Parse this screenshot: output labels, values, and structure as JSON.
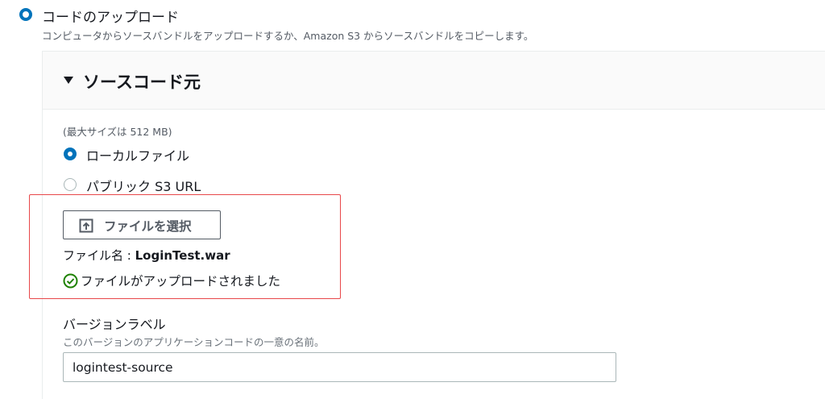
{
  "upload_option": {
    "label": "コードのアップロード",
    "description": "コンピュータからソースバンドルをアップロードするか、Amazon S3 からソースバンドルをコピーします。",
    "selected": true
  },
  "source_section": {
    "title": "ソースコード元",
    "max_size_hint": "(最大サイズは 512 MB)",
    "options": [
      {
        "label": "ローカルファイル",
        "selected": true
      },
      {
        "label": "パブリック S3 URL",
        "selected": false
      }
    ],
    "choose_file_button": "ファイルを選択",
    "file_name_label": "ファイル名 :",
    "file_name_value": "LoginTest.war",
    "upload_status": "ファイルがアップロードされました"
  },
  "version_label": {
    "title": "バージョンラベル",
    "description": "このバージョンのアプリケーションコードの一意の名前。",
    "value": "logintest-source"
  },
  "colors": {
    "accent": "#0073bb",
    "highlight_border": "#e8474a",
    "success": "#1d8102"
  },
  "icons": {
    "caret": "caret-down-icon",
    "upload": "upload-icon",
    "success": "check-circle-icon"
  }
}
